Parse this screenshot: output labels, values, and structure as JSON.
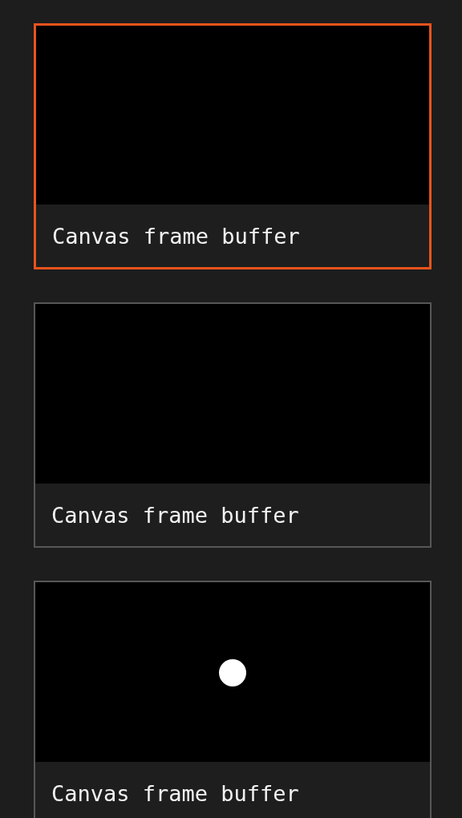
{
  "frames": [
    {
      "caption": "Canvas frame buffer",
      "selected": true,
      "kind": "blank"
    },
    {
      "caption": "Canvas frame buffer",
      "selected": false,
      "kind": "blank"
    },
    {
      "caption": "Canvas frame buffer",
      "selected": false,
      "kind": "dot"
    }
  ]
}
